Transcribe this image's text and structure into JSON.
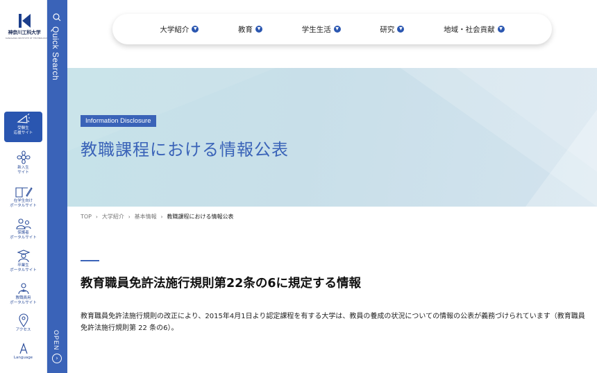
{
  "logo": {
    "name": "神奈川工科大学",
    "sub": "KANAGAWA INSTITUTE OF TECHNOLOGY"
  },
  "sidebar": {
    "items": [
      {
        "line1": "受験生",
        "line2": "応援サイト",
        "icon": "megaphone-icon"
      },
      {
        "line1": "新入生",
        "line2": "サイト",
        "icon": "flower-icon"
      },
      {
        "line1": "在学生向け",
        "line2": "ポータルサイト",
        "icon": "book-pen-icon"
      },
      {
        "line1": "保護者",
        "line2": "ポータルサイト",
        "icon": "parents-icon"
      },
      {
        "line1": "卒業生",
        "line2": "ポータルサイト",
        "icon": "graduate-icon"
      },
      {
        "line1": "教職員用",
        "line2": "ポータルサイト",
        "icon": "staff-icon"
      },
      {
        "line1": "アクセス",
        "line2": "",
        "icon": "map-pin-icon"
      },
      {
        "line1": "Language",
        "line2": "",
        "icon": "language-icon"
      }
    ]
  },
  "quick_search": {
    "label": "Quick Search",
    "open_label": "OPEN",
    "icon": "search-icon"
  },
  "nav": {
    "items": [
      {
        "label": "大学紹介"
      },
      {
        "label": "教育"
      },
      {
        "label": "学生生活"
      },
      {
        "label": "研究"
      },
      {
        "label": "地域・社会貢献"
      }
    ]
  },
  "hero": {
    "badge": "Information Disclosure",
    "title": "教職課程における情報公表"
  },
  "breadcrumb": {
    "items": [
      "TOP",
      "大学紹介",
      "基本情報"
    ],
    "current": "教職課程における情報公表"
  },
  "content": {
    "section_title": "教育職員免許法施行規則第22条の6に規定する情報",
    "body": "教育職員免許法施行規則の改正により、2015年4月1日より認定課程を有する大学は、教員の養成の状況についての情報の公表が義務づけられています（教育職員免許法施行規則第 22 条の6）。"
  },
  "colors": {
    "brand": "#3a63b8",
    "active": "#2a56b0",
    "hero_bg": "#c8dfe9"
  }
}
